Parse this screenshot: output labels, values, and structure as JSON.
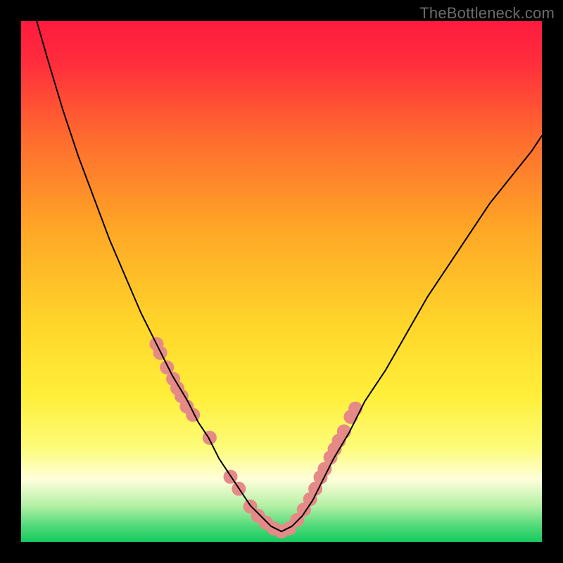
{
  "watermark": "TheBottleneck.com",
  "chart_data": {
    "type": "line",
    "title": "",
    "xlabel": "",
    "ylabel": "",
    "xlim": [
      0,
      100
    ],
    "ylim": [
      0,
      100
    ],
    "background_gradient_stops": [
      {
        "offset": 0,
        "color": "#ff1a3f"
      },
      {
        "offset": 0.08,
        "color": "#ff2d3c"
      },
      {
        "offset": 0.22,
        "color": "#ff6a2f"
      },
      {
        "offset": 0.4,
        "color": "#ffa726"
      },
      {
        "offset": 0.58,
        "color": "#ffd52a"
      },
      {
        "offset": 0.72,
        "color": "#ffef3a"
      },
      {
        "offset": 0.82,
        "color": "#fdfc7a"
      },
      {
        "offset": 0.88,
        "color": "#fefedb"
      },
      {
        "offset": 0.93,
        "color": "#b5f0a6"
      },
      {
        "offset": 0.97,
        "color": "#4fd979"
      },
      {
        "offset": 1.0,
        "color": "#15c95f"
      }
    ],
    "series": [
      {
        "name": "bottleneck-curve",
        "color": "#000000",
        "stroke_width": 2,
        "x": [
          3,
          5,
          8,
          11,
          14,
          17,
          20,
          23,
          26,
          29,
          32,
          34,
          36,
          38,
          40,
          42,
          44,
          46,
          48,
          50,
          52,
          54,
          56,
          58,
          60,
          63,
          66,
          70,
          74,
          78,
          82,
          86,
          90,
          94,
          98,
          100
        ],
        "y": [
          100,
          93,
          83,
          74,
          66,
          58,
          51,
          44,
          38,
          32,
          27,
          23,
          20,
          16,
          13,
          10,
          7,
          5,
          3,
          2,
          3,
          5,
          8,
          12,
          16,
          21,
          27,
          33,
          40,
          47,
          53,
          59,
          65,
          70,
          75,
          78
        ]
      }
    ],
    "highlight_dots": {
      "name": "highlight-points",
      "color": "#e58a87",
      "radius": 10,
      "x": [
        26,
        26.7,
        28,
        29.2,
        30,
        30.8,
        31.8,
        33,
        36.2,
        40.2,
        41.8,
        44,
        45.5,
        47,
        48.5,
        50,
        51.5,
        53,
        54.3,
        55.5,
        56.5,
        57.5,
        58.3,
        59.4,
        60.2,
        61,
        62,
        63.3,
        64.2
      ],
      "y": [
        38,
        36.3,
        33.5,
        31.3,
        29.5,
        28,
        26,
        24.4,
        20,
        12.5,
        10.2,
        6.8,
        5,
        3.7,
        2.6,
        2,
        2.6,
        4.2,
        6.2,
        8.2,
        10.2,
        12.4,
        14,
        16.2,
        17.8,
        19.4,
        21.2,
        24,
        25.6
      ]
    }
  }
}
